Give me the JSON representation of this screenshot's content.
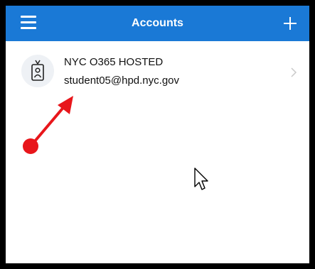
{
  "header": {
    "title": "Accounts",
    "background_color": "#1a79d6",
    "menu_icon": "hamburger-menu-icon",
    "add_icon": "plus-icon"
  },
  "accounts": [
    {
      "name": "NYC O365 HOSTED",
      "email": "student05@hpd.nyc.gov",
      "icon": "id-badge-icon",
      "trailing_icon": "chevron-right-icon"
    }
  ],
  "annotation": {
    "type": "red-arrow",
    "color": "#e8161b"
  },
  "cursor_icon": "mouse-pointer-icon"
}
